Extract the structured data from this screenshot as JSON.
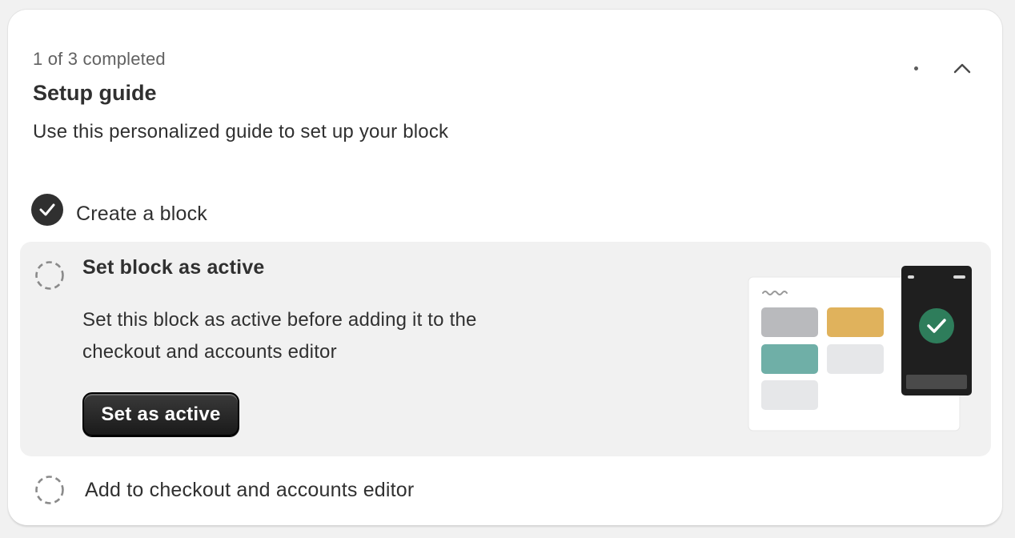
{
  "setup_guide": {
    "progress_text": "1 of 3 completed",
    "title": "Setup guide",
    "subtitle": "Use this personalized guide to set up your block",
    "menu_icon": "more-horizontal-icon",
    "collapse_icon": "chevron-up-icon"
  },
  "steps": [
    {
      "label": "Create a block",
      "status": "completed",
      "icon": "check-circle-icon"
    },
    {
      "label": "Set block as active",
      "status": "active",
      "icon": "dashed-circle-icon",
      "description": "Set this block as active before adding it to the checkout and accounts editor",
      "button_label": "Set as active"
    },
    {
      "label": "Add to checkout and accounts editor",
      "status": "pending",
      "icon": "dashed-circle-icon"
    }
  ],
  "colors": {
    "card_bg": "#ffffff",
    "page_bg": "#f1f1f1",
    "active_step_bg": "#f1f1f1",
    "primary_button": "#1a1a1a",
    "success_green": "#2e7d5b",
    "tile_gold": "#e0b25c",
    "tile_teal": "#6fafa7"
  }
}
